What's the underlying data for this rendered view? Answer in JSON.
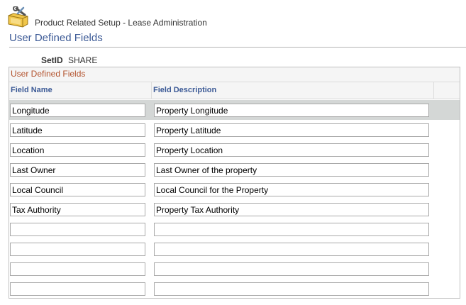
{
  "header": {
    "breadcrumb": "Product Related Setup - Lease Administration",
    "page_title": "User Defined Fields"
  },
  "setid": {
    "label": "SetID",
    "value": "SHARE"
  },
  "grid": {
    "title": "User Defined Fields",
    "columns": {
      "field_name": "Field Name",
      "field_description": "Field Description"
    },
    "rows": [
      {
        "name": "Longitude",
        "description": "Property Longitude"
      },
      {
        "name": "Latitude",
        "description": "Property Latitude"
      },
      {
        "name": "Location",
        "description": "Property Location"
      },
      {
        "name": "Last Owner",
        "description": "Last Owner of the property"
      },
      {
        "name": "Local Council",
        "description": "Local Council for the Property"
      },
      {
        "name": "Tax Authority",
        "description": "Property Tax Authority"
      },
      {
        "name": "",
        "description": ""
      },
      {
        "name": "",
        "description": ""
      },
      {
        "name": "",
        "description": ""
      },
      {
        "name": "",
        "description": ""
      }
    ]
  },
  "colors": {
    "title": "#3c5a96",
    "grid_title": "#b3532e",
    "active_row": "#d4d7d6"
  }
}
